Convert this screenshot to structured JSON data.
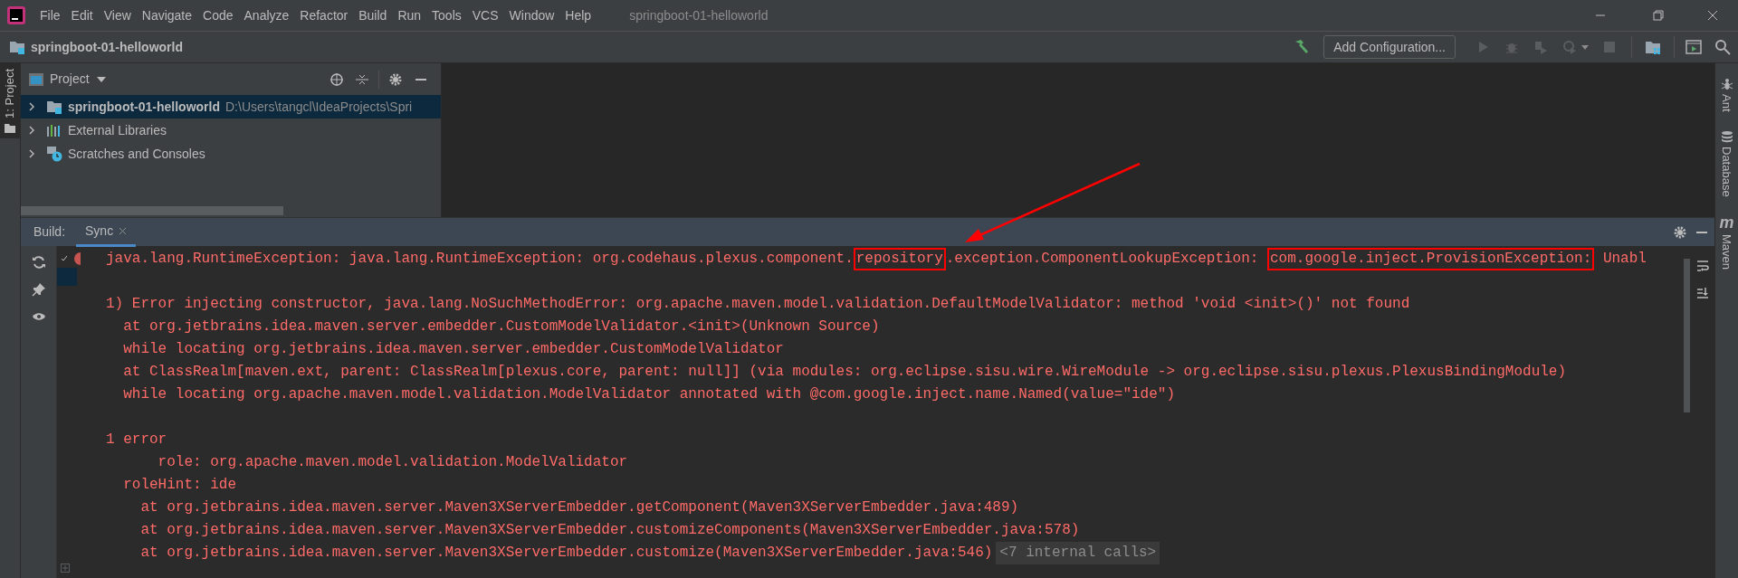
{
  "menu": [
    "File",
    "Edit",
    "View",
    "Navigate",
    "Code",
    "Analyze",
    "Refactor",
    "Build",
    "Run",
    "Tools",
    "VCS",
    "Window",
    "Help"
  ],
  "window_title": "springboot-01-helloworld",
  "nav_bar": {
    "project": "springboot-01-helloworld"
  },
  "toolbar": {
    "run_config": "Add Configuration..."
  },
  "left_stripe": [
    {
      "label": "1: Project",
      "selected": true
    }
  ],
  "project_panel": {
    "title": "Project",
    "tree": [
      {
        "label": "springboot-01-helloworld",
        "path": "D:\\Users\\tangcl\\IdeaProjects\\Spri",
        "kind": "module",
        "selected": true,
        "expanded": false
      },
      {
        "label": "External Libraries",
        "kind": "libraries",
        "selected": false,
        "expanded": false
      },
      {
        "label": "Scratches and Consoles",
        "kind": "scratches",
        "selected": false,
        "expanded": false
      }
    ]
  },
  "right_stripe": [
    {
      "label": "Ant",
      "kind": "ant"
    },
    {
      "label": "Database",
      "kind": "database"
    },
    {
      "label": "Maven",
      "kind": "maven",
      "icon_text": "m"
    }
  ],
  "build_panel": {
    "label": "Build:",
    "tabs": [
      {
        "label": "Sync",
        "selected": true
      }
    ],
    "output_blocks": [
      {
        "lines": [
          {
            "segments": [
              {
                "text": "java.lang.RuntimeException: java.lang.RuntimeException: org.codehaus.plexus.component.",
                "boxed": false
              },
              {
                "text": "repository",
                "boxed": true
              },
              {
                "text": ".exception.ComponentLookupException: ",
                "boxed": false
              },
              {
                "text": "com.google.inject.ProvisionException:",
                "boxed": true
              },
              {
                "text": " Unabl",
                "boxed": false
              }
            ]
          }
        ]
      },
      {
        "lines": [
          {
            "text": "1) Error injecting constructor, java.lang.NoSuchMethodError: org.apache.maven.model.validation.DefaultModelValidator: method 'void <init>()' not found"
          },
          {
            "text": "  at org.jetbrains.idea.maven.server.embedder.CustomModelValidator.<init>(Unknown Source)"
          },
          {
            "text": "  while locating org.jetbrains.idea.maven.server.embedder.CustomModelValidator"
          },
          {
            "text": "  at ClassRealm[maven.ext, parent: ClassRealm[plexus.core, parent: null]] (via modules: org.eclipse.sisu.wire.WireModule -> org.eclipse.sisu.plexus.PlexusBindingModule)"
          },
          {
            "text": "  while locating org.apache.maven.model.validation.ModelValidator annotated with @com.google.inject.name.Named(value=\"ide\")"
          }
        ]
      },
      {
        "lines": [
          {
            "text": "1 error"
          },
          {
            "text": "      role: org.apache.maven.model.validation.ModelValidator"
          },
          {
            "text": "  roleHint: ide"
          },
          {
            "text": "    at org.jetbrains.idea.maven.server.Maven3XServerEmbedder.getComponent(Maven3XServerEmbedder.java:489)"
          },
          {
            "text": "    at org.jetbrains.idea.maven.server.Maven3XServerEmbedder.customizeComponents(Maven3XServerEmbedder.java:578)"
          },
          {
            "text": "    at org.jetbrains.idea.maven.server.Maven3XServerEmbedder.customize(Maven3XServerEmbedder.java:546)",
            "folded": "<7 internal calls>"
          }
        ]
      }
    ]
  }
}
